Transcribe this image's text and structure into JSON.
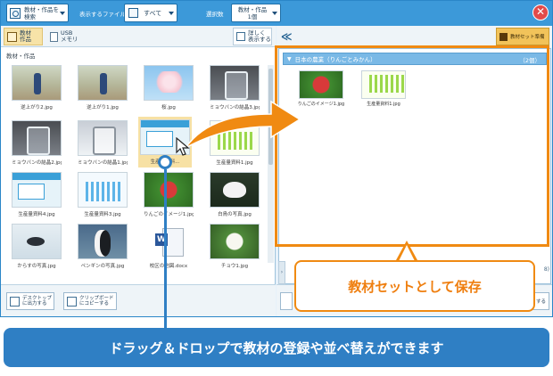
{
  "toolbar": {
    "search_label": "教材・作品を\n検索",
    "filetype_label": "表示するファイル",
    "filetype_value": "すべて",
    "selcount_label": "選択数",
    "selcount_value": "教材・作品\n1個",
    "close_symbol": "✕"
  },
  "left": {
    "tab_works": "教材\n作品",
    "tab_usb": "USB\nメモリ",
    "tab_detail": "詳しく\n表示する",
    "breadcrumb": "教材・作品",
    "thumbnails": [
      {
        "caption": "逆上がり2.jpg"
      },
      {
        "caption": "逆上がり1.jpg"
      },
      {
        "caption": "桜.jpg"
      },
      {
        "caption": "ミョウバンの結晶3.jpg"
      },
      {
        "caption": "ミョウバンの結晶2.jpg"
      },
      {
        "caption": "ミョウバンの結晶1.jpg"
      },
      {
        "caption": "生産量資料..."
      },
      {
        "caption": "生産量資料1.jpg"
      },
      {
        "caption": "生産量資料4.jpg"
      },
      {
        "caption": "生産量資料3.jpg"
      },
      {
        "caption": "りんごのイメージ1.jpg"
      },
      {
        "caption": "白鳥の写真.jpg"
      },
      {
        "caption": "からすの写真.jpg"
      },
      {
        "caption": "ペンギンの写真.jpg"
      },
      {
        "caption": "校区の地図.docx"
      },
      {
        "caption": "チョウ1.jpg"
      }
    ],
    "export_label": "デスクトップ\nに出力する",
    "copy_label": "クリップボード\nにコピーする"
  },
  "right": {
    "collapse_symbol": "≪",
    "set_tab_label": "教材セット準備",
    "group_title": "日本の農業（りんごとみかん）",
    "group_count": "（2個）",
    "items": [
      {
        "caption": "りんごのイメージ1.jpg"
      },
      {
        "caption": "生産量資料1.jpg"
      }
    ],
    "count_peek": "8)",
    "bottom_stub": "する"
  },
  "overlay": {
    "callout_text": "教材セットとして保存",
    "banner_text": "ドラッグ＆ドロップで教材の登録や並べ替えができます"
  },
  "colors": {
    "toolbar_blue": "#3c99d9",
    "accent_orange": "#f08a12",
    "banner_blue": "#2f7fc4",
    "close_red": "#e24a4a"
  }
}
